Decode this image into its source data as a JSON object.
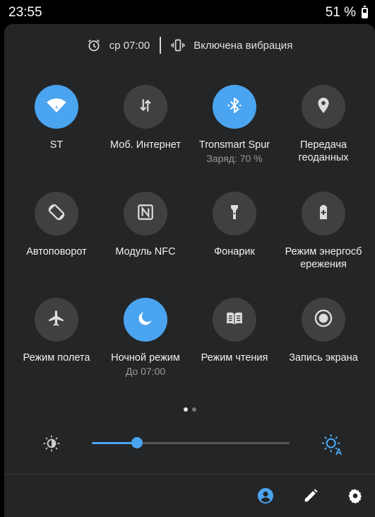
{
  "status_bar": {
    "time": "23:55",
    "battery": "51 %"
  },
  "alarm_row": {
    "alarm": "ср 07:00",
    "vibration": "Включена вибрация"
  },
  "tiles": [
    {
      "label": "ST",
      "sub": "",
      "on": true,
      "icon": "wifi-icon"
    },
    {
      "label": "Моб. Интернет",
      "sub": "",
      "on": false,
      "icon": "mobile-data-icon"
    },
    {
      "label": "Tronsmart Spur",
      "sub": "Заряд: 70 %",
      "on": true,
      "icon": "bluetooth-icon"
    },
    {
      "label": "Передача\nгеоданных",
      "sub": "",
      "on": false,
      "icon": "location-icon"
    },
    {
      "label": "Автоповорот",
      "sub": "",
      "on": false,
      "icon": "auto-rotate-icon"
    },
    {
      "label": "Модуль NFC",
      "sub": "",
      "on": false,
      "icon": "nfc-icon"
    },
    {
      "label": "Фонарик",
      "sub": "",
      "on": false,
      "icon": "flashlight-icon"
    },
    {
      "label": "Режим энергосб\nережения",
      "sub": "",
      "on": false,
      "icon": "battery-saver-icon"
    },
    {
      "label": "Режим полета",
      "sub": "",
      "on": false,
      "icon": "airplane-icon"
    },
    {
      "label": "Ночной режим",
      "sub": "До 07:00",
      "on": true,
      "icon": "night-mode-icon"
    },
    {
      "label": "Режим чтения",
      "sub": "",
      "on": false,
      "icon": "reading-mode-icon"
    },
    {
      "label": "Запись экрана",
      "sub": "",
      "on": false,
      "icon": "screen-record-icon"
    }
  ],
  "pager": {
    "pages": 2,
    "current": 1
  },
  "brightness": {
    "level": 0.23
  },
  "colors": {
    "accent": "#4aa4f0",
    "panel": "#242526",
    "tile_off": "#3f4041"
  }
}
